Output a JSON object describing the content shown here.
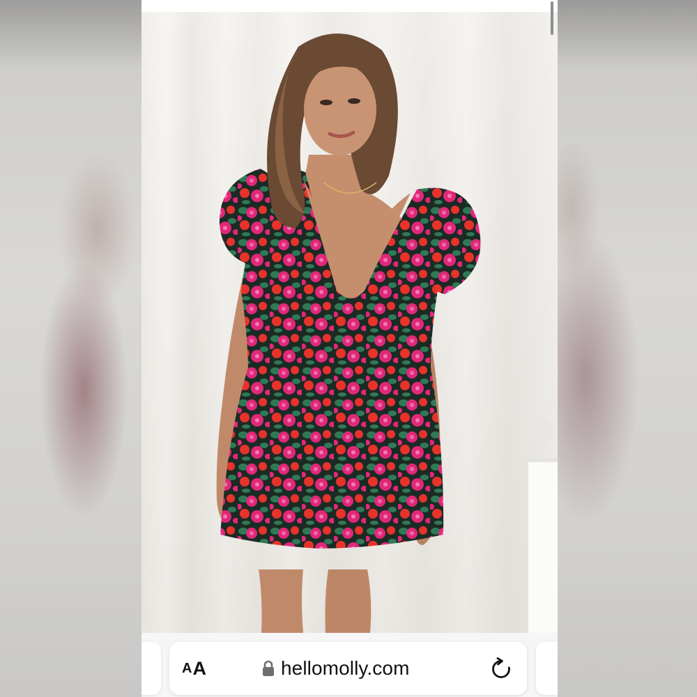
{
  "browser": {
    "text_size_button": {
      "small": "A",
      "large": "A"
    },
    "address": "hellomolly.com",
    "secure": true
  },
  "product_photo": {
    "subject": "model wearing floral mini dress with puff sleeves",
    "colors": {
      "backdrop": "#f0eeea",
      "fabric_base": "#1c2a24",
      "floral_pink": "#e0287a",
      "floral_red": "#e8322c",
      "floral_green": "#2f7a55",
      "skin": "#c08a6a",
      "hair": "#6b4a33"
    }
  },
  "icons": {
    "lock": "lock-icon",
    "reload": "reload-icon"
  }
}
